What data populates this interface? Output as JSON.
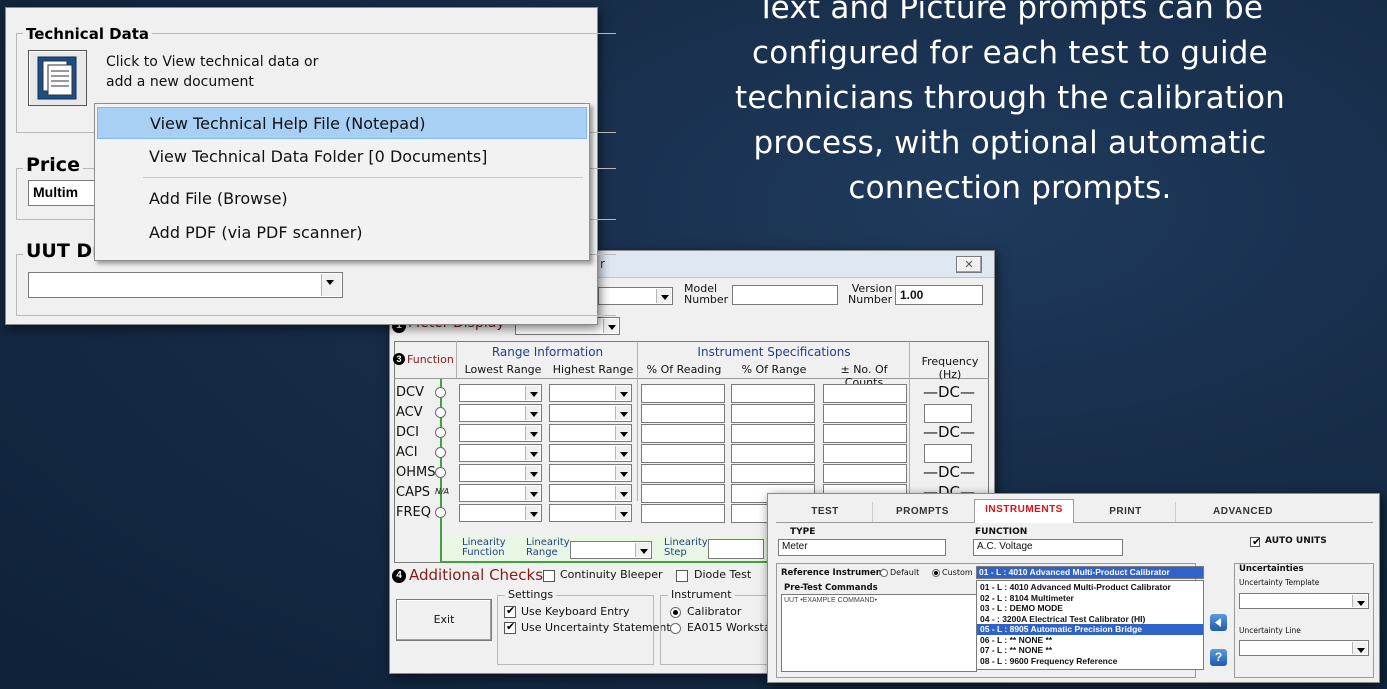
{
  "caption": {
    "lines": [
      "Text and Picture prompts can be",
      "configured for each test to guide",
      "technicians through the calibration",
      "process, with optional automatic",
      "connection prompts."
    ]
  },
  "tech_window": {
    "technical_data_title": "Technical Data",
    "technical_data_hint_line1": "Click to View technical data or",
    "technical_data_hint_line2": "add a new document",
    "price_title": "Price",
    "price_value": "Multim",
    "uut_title": "UUT Drive:",
    "uut_value": "",
    "menu": [
      "View Technical Help File (Notepad)",
      "View Technical Data Folder [0 Documents]",
      "Add File (Browse)",
      "Add PDF (via PDF scanner)"
    ]
  },
  "meter_window": {
    "title_fragment": "r",
    "close_glyph": "✕",
    "model_label_1": "Model",
    "model_label_2": "Number",
    "version_label_1": "Version",
    "version_label_2": "Number",
    "version_value": "1.00",
    "meter_display_label": "Meter Display",
    "function_label": "Function",
    "range_info": "Range Information",
    "lowest_range": "Lowest Range",
    "highest_range": "Highest Range",
    "instrument_specs": "Instrument Specifications",
    "pct_reading": "% Of Reading",
    "pct_range": "% Of Range",
    "no_counts": "± No. Of Counts",
    "frequency": "Frequency (Hz)",
    "rows": [
      "DCV",
      "ACV",
      "DCI",
      "ACI",
      "OHMS",
      "CAPS",
      "FREQ"
    ],
    "dc_text": "—DC—",
    "na_text": "N/A",
    "linearity_function_1": "Linearity",
    "linearity_function_2": "Function",
    "linearity_range_1": "Linearity",
    "linearity_range_2": "Range",
    "linearity_step_1": "Linearity",
    "linearity_step_2": "Step",
    "additional_checks": "Additional Checks",
    "continuity": "Continuity Bleeper",
    "diode": "Diode Test",
    "settings_title": "Settings",
    "use_keyboard": "Use Keyboard Entry",
    "use_uncert": "Use Uncertainty Statements",
    "instrument_title": "Instrument",
    "calibrator": "Calibrator",
    "ea015": "EA015 Workstati",
    "exit": "Exit",
    "step3": "3",
    "step4": "4",
    "step1": "1"
  },
  "instruments_window": {
    "tabs": [
      "TEST",
      "PROMPTS",
      "INSTRUMENTS",
      "PRINT",
      "ADVANCED"
    ],
    "type_label": "TYPE",
    "type_value": "Meter",
    "function_label": "FUNCTION",
    "function_value": "A.C. Voltage",
    "auto_units": "AUTO UNITS",
    "ref_instrument": "Reference Instrument",
    "default_opt": "Default",
    "custom_opt": "Custom",
    "selected_instrument": "01 - L : 4010 Advanced Multi-Product Calibrator",
    "pretest_label": "Pre-Test Commands",
    "pretest_value": "UUT •EXAMPLE COMMAND•",
    "instrument_list": [
      "01 - L : 4010 Advanced Multi-Product Calibrator",
      "02 - L : 8104 Multimeter",
      "03 - L : DEMO MODE",
      "04 - : 3200A Electrical Test Calibrator (HI)",
      "05 - L : 8905 Automatic Precision Bridge",
      "06 - L : ** NONE **",
      "07 - L : ** NONE **",
      "08 - L : 9600 Frequency Reference"
    ],
    "uncertainties": "Uncertainties",
    "uncert_template": "Uncertainty Template",
    "uncert_line": "Uncertainty Line"
  }
}
